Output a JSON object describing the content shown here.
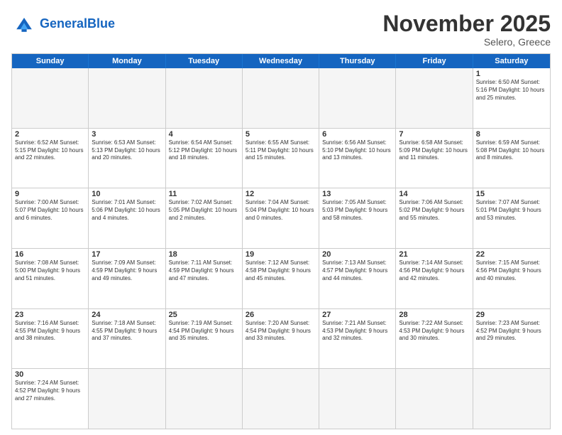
{
  "header": {
    "logo_general": "General",
    "logo_blue": "Blue",
    "month_title": "November 2025",
    "subtitle": "Selero, Greece"
  },
  "days_of_week": [
    "Sunday",
    "Monday",
    "Tuesday",
    "Wednesday",
    "Thursday",
    "Friday",
    "Saturday"
  ],
  "weeks": [
    [
      {
        "day": "",
        "text": "",
        "empty": true
      },
      {
        "day": "",
        "text": "",
        "empty": true
      },
      {
        "day": "",
        "text": "",
        "empty": true
      },
      {
        "day": "",
        "text": "",
        "empty": true
      },
      {
        "day": "",
        "text": "",
        "empty": true
      },
      {
        "day": "",
        "text": "",
        "empty": true
      },
      {
        "day": "1",
        "text": "Sunrise: 6:50 AM\nSunset: 5:16 PM\nDaylight: 10 hours\nand 25 minutes.",
        "empty": false
      }
    ],
    [
      {
        "day": "2",
        "text": "Sunrise: 6:52 AM\nSunset: 5:15 PM\nDaylight: 10 hours\nand 22 minutes.",
        "empty": false
      },
      {
        "day": "3",
        "text": "Sunrise: 6:53 AM\nSunset: 5:13 PM\nDaylight: 10 hours\nand 20 minutes.",
        "empty": false
      },
      {
        "day": "4",
        "text": "Sunrise: 6:54 AM\nSunset: 5:12 PM\nDaylight: 10 hours\nand 18 minutes.",
        "empty": false
      },
      {
        "day": "5",
        "text": "Sunrise: 6:55 AM\nSunset: 5:11 PM\nDaylight: 10 hours\nand 15 minutes.",
        "empty": false
      },
      {
        "day": "6",
        "text": "Sunrise: 6:56 AM\nSunset: 5:10 PM\nDaylight: 10 hours\nand 13 minutes.",
        "empty": false
      },
      {
        "day": "7",
        "text": "Sunrise: 6:58 AM\nSunset: 5:09 PM\nDaylight: 10 hours\nand 11 minutes.",
        "empty": false
      },
      {
        "day": "8",
        "text": "Sunrise: 6:59 AM\nSunset: 5:08 PM\nDaylight: 10 hours\nand 8 minutes.",
        "empty": false
      }
    ],
    [
      {
        "day": "9",
        "text": "Sunrise: 7:00 AM\nSunset: 5:07 PM\nDaylight: 10 hours\nand 6 minutes.",
        "empty": false
      },
      {
        "day": "10",
        "text": "Sunrise: 7:01 AM\nSunset: 5:06 PM\nDaylight: 10 hours\nand 4 minutes.",
        "empty": false
      },
      {
        "day": "11",
        "text": "Sunrise: 7:02 AM\nSunset: 5:05 PM\nDaylight: 10 hours\nand 2 minutes.",
        "empty": false
      },
      {
        "day": "12",
        "text": "Sunrise: 7:04 AM\nSunset: 5:04 PM\nDaylight: 10 hours\nand 0 minutes.",
        "empty": false
      },
      {
        "day": "13",
        "text": "Sunrise: 7:05 AM\nSunset: 5:03 PM\nDaylight: 9 hours\nand 58 minutes.",
        "empty": false
      },
      {
        "day": "14",
        "text": "Sunrise: 7:06 AM\nSunset: 5:02 PM\nDaylight: 9 hours\nand 55 minutes.",
        "empty": false
      },
      {
        "day": "15",
        "text": "Sunrise: 7:07 AM\nSunset: 5:01 PM\nDaylight: 9 hours\nand 53 minutes.",
        "empty": false
      }
    ],
    [
      {
        "day": "16",
        "text": "Sunrise: 7:08 AM\nSunset: 5:00 PM\nDaylight: 9 hours\nand 51 minutes.",
        "empty": false
      },
      {
        "day": "17",
        "text": "Sunrise: 7:09 AM\nSunset: 4:59 PM\nDaylight: 9 hours\nand 49 minutes.",
        "empty": false
      },
      {
        "day": "18",
        "text": "Sunrise: 7:11 AM\nSunset: 4:59 PM\nDaylight: 9 hours\nand 47 minutes.",
        "empty": false
      },
      {
        "day": "19",
        "text": "Sunrise: 7:12 AM\nSunset: 4:58 PM\nDaylight: 9 hours\nand 45 minutes.",
        "empty": false
      },
      {
        "day": "20",
        "text": "Sunrise: 7:13 AM\nSunset: 4:57 PM\nDaylight: 9 hours\nand 44 minutes.",
        "empty": false
      },
      {
        "day": "21",
        "text": "Sunrise: 7:14 AM\nSunset: 4:56 PM\nDaylight: 9 hours\nand 42 minutes.",
        "empty": false
      },
      {
        "day": "22",
        "text": "Sunrise: 7:15 AM\nSunset: 4:56 PM\nDaylight: 9 hours\nand 40 minutes.",
        "empty": false
      }
    ],
    [
      {
        "day": "23",
        "text": "Sunrise: 7:16 AM\nSunset: 4:55 PM\nDaylight: 9 hours\nand 38 minutes.",
        "empty": false
      },
      {
        "day": "24",
        "text": "Sunrise: 7:18 AM\nSunset: 4:55 PM\nDaylight: 9 hours\nand 37 minutes.",
        "empty": false
      },
      {
        "day": "25",
        "text": "Sunrise: 7:19 AM\nSunset: 4:54 PM\nDaylight: 9 hours\nand 35 minutes.",
        "empty": false
      },
      {
        "day": "26",
        "text": "Sunrise: 7:20 AM\nSunset: 4:54 PM\nDaylight: 9 hours\nand 33 minutes.",
        "empty": false
      },
      {
        "day": "27",
        "text": "Sunrise: 7:21 AM\nSunset: 4:53 PM\nDaylight: 9 hours\nand 32 minutes.",
        "empty": false
      },
      {
        "day": "28",
        "text": "Sunrise: 7:22 AM\nSunset: 4:53 PM\nDaylight: 9 hours\nand 30 minutes.",
        "empty": false
      },
      {
        "day": "29",
        "text": "Sunrise: 7:23 AM\nSunset: 4:52 PM\nDaylight: 9 hours\nand 29 minutes.",
        "empty": false
      }
    ],
    [
      {
        "day": "30",
        "text": "Sunrise: 7:24 AM\nSunset: 4:52 PM\nDaylight: 9 hours\nand 27 minutes.",
        "empty": false
      },
      {
        "day": "",
        "text": "",
        "empty": true
      },
      {
        "day": "",
        "text": "",
        "empty": true
      },
      {
        "day": "",
        "text": "",
        "empty": true
      },
      {
        "day": "",
        "text": "",
        "empty": true
      },
      {
        "day": "",
        "text": "",
        "empty": true
      },
      {
        "day": "",
        "text": "",
        "empty": true
      }
    ]
  ]
}
